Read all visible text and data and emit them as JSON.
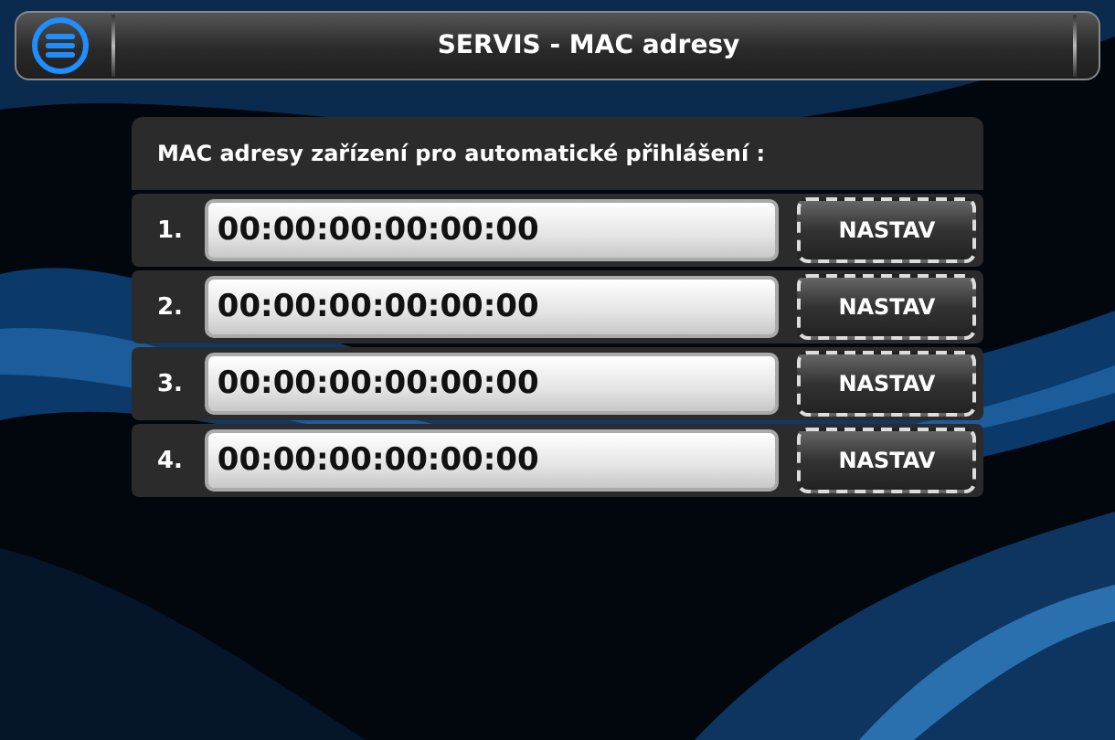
{
  "header": {
    "title": "SERVIS - MAC adresy"
  },
  "panel": {
    "heading": "MAC adresy zařízení pro automatické přihlášení :",
    "rows": [
      {
        "number": "1.",
        "value": "00:00:00:00:00:00",
        "button": "NASTAV"
      },
      {
        "number": "2.",
        "value": "00:00:00:00:00:00",
        "button": "NASTAV"
      },
      {
        "number": "3.",
        "value": "00:00:00:00:00:00",
        "button": "NASTAV"
      },
      {
        "number": "4.",
        "value": "00:00:00:00:00:00",
        "button": "NASTAV"
      }
    ]
  }
}
